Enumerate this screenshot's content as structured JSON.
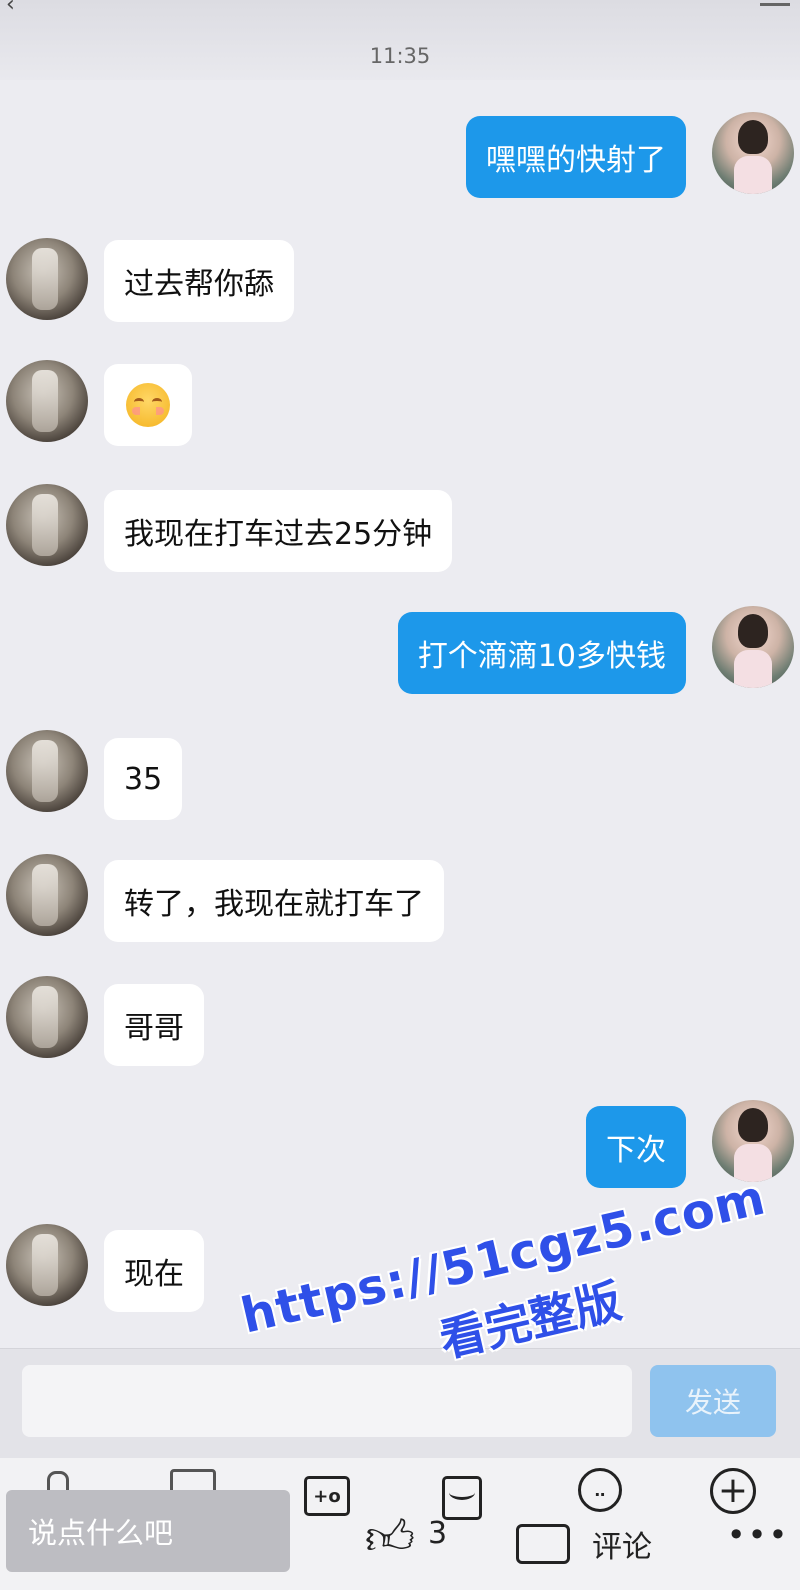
{
  "header": {
    "timestamp": "11:35"
  },
  "messages": [
    {
      "sender": "self",
      "type": "text",
      "text": "嘿嘿的快射了"
    },
    {
      "sender": "other",
      "type": "text",
      "text": "过去帮你舔"
    },
    {
      "sender": "other",
      "type": "emoji",
      "emoji": "shy-blushing-emoji"
    },
    {
      "sender": "other",
      "type": "text",
      "text": "我现在打车过去25分钟"
    },
    {
      "sender": "self",
      "type": "text",
      "text": "打个滴滴10多快钱"
    },
    {
      "sender": "other",
      "type": "text",
      "text": "35"
    },
    {
      "sender": "other",
      "type": "text",
      "text": "转了，我现在就打车了"
    },
    {
      "sender": "other",
      "type": "text",
      "text": "哥哥"
    },
    {
      "sender": "self",
      "type": "text",
      "text": "下次"
    },
    {
      "sender": "other",
      "type": "text",
      "text": "现在"
    }
  ],
  "composer": {
    "send_label": "发送"
  },
  "bottom_bar": {
    "comment_placeholder": "说点什么吧",
    "like_count": "3",
    "comment_label": "评论"
  },
  "watermark": {
    "url": "https://51cgz5.com",
    "text": "看完整版"
  },
  "colors": {
    "self_bubble": "#1d98ea",
    "other_bubble": "#ffffff",
    "background": "#ececf1",
    "watermark": "#2f50e8"
  }
}
